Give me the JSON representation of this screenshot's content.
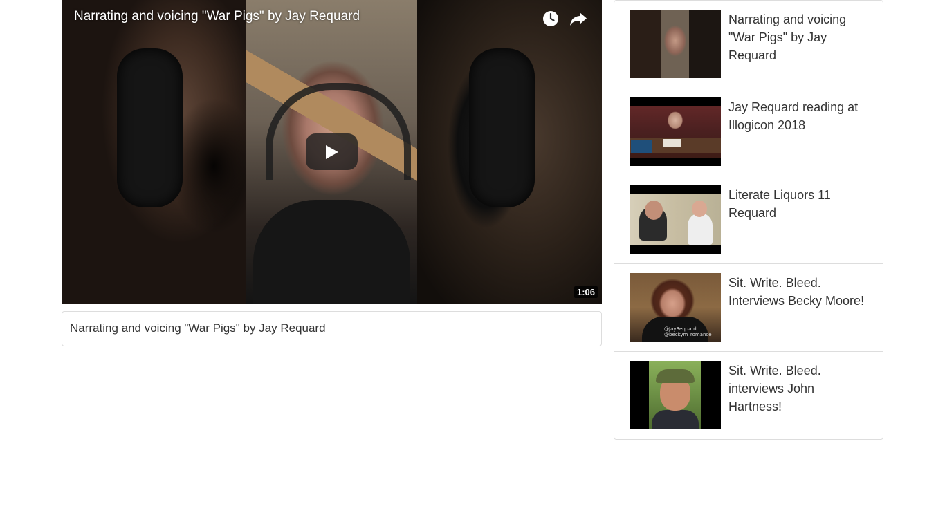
{
  "player": {
    "title": "Narrating and voicing \"War Pigs\" by Jay Requard",
    "duration": "1:06",
    "icons": {
      "watch_later": "clock-icon",
      "share": "share-arrow-icon",
      "play": "play-icon"
    }
  },
  "caption": {
    "text": "Narrating and voicing \"War Pigs\" by Jay Requard"
  },
  "playlist": {
    "items": [
      {
        "title": "Narrating and voicing \"War Pigs\" by Jay Requard"
      },
      {
        "title": "Jay Requard reading at Illogicon 2018"
      },
      {
        "title": "Literate Liquors 11 Requard"
      },
      {
        "title": "Sit. Write. Bleed. Interviews Becky Moore!",
        "thumb_text": "@JayRequard\n@beckym_romance"
      },
      {
        "title": "Sit. Write. Bleed. interviews John Hartness!"
      }
    ]
  }
}
